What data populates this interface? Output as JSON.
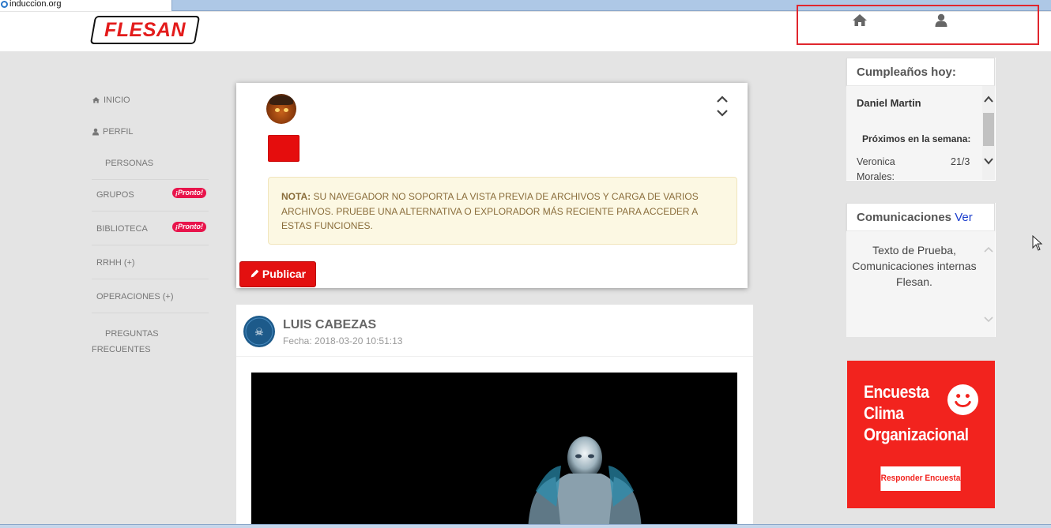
{
  "browser": {
    "tab_title": "induccion.org"
  },
  "header": {
    "logo_text": "FLESAN",
    "icons": [
      "home-icon",
      "user-icon"
    ]
  },
  "nav": {
    "items": [
      {
        "label": "INICIO",
        "icon": "home-icon"
      },
      {
        "label": "PERFIL",
        "icon": "user-icon"
      },
      {
        "label": "PERSONAS"
      },
      {
        "label": "GRUPOS",
        "badge": "¡Pronto!"
      },
      {
        "label": "BIBLIOTECA",
        "badge": "¡Pronto!"
      },
      {
        "label": "RRHH (+)"
      },
      {
        "label": "OPERACIONES (+)"
      },
      {
        "label": "PREGUNTAS FRECUENTES"
      }
    ]
  },
  "composer": {
    "notice_bold": "NOTA:",
    "notice_text": " SU NAVEGADOR NO SOPORTA LA VISTA PREVIA DE ARCHIVOS Y CARGA DE VARIOS ARCHIVOS. PRUEBE UNA ALTERNATIVA O EXPLORADOR MÁS RECIENTE PARA ACCEDER A ESTAS FUNCIONES.",
    "publish_label": "Publicar"
  },
  "post": {
    "author": "LUIS CABEZAS",
    "date": "Fecha: 2018-03-20 10:51:13"
  },
  "birthdays": {
    "title": "Cumpleaños hoy:",
    "today_name": "Daniel Martin",
    "upcoming_title": "Próximos en la semana:",
    "upcoming": [
      {
        "name": "Veronica Morales:",
        "date": "21/3"
      }
    ]
  },
  "communications": {
    "title": "Comunicaciones",
    "link": "Ver",
    "text": "Texto de Prueba, Comunicaciones internas Flesan."
  },
  "survey": {
    "title_line1": "Encuesta",
    "title_line2": "Clima",
    "title_line3": "Organizacional",
    "button_label": "Responder Encuesta"
  },
  "colors": {
    "brand_red": "#e31010",
    "survey_red": "#f2231e",
    "badge_pink": "#e8144b"
  }
}
